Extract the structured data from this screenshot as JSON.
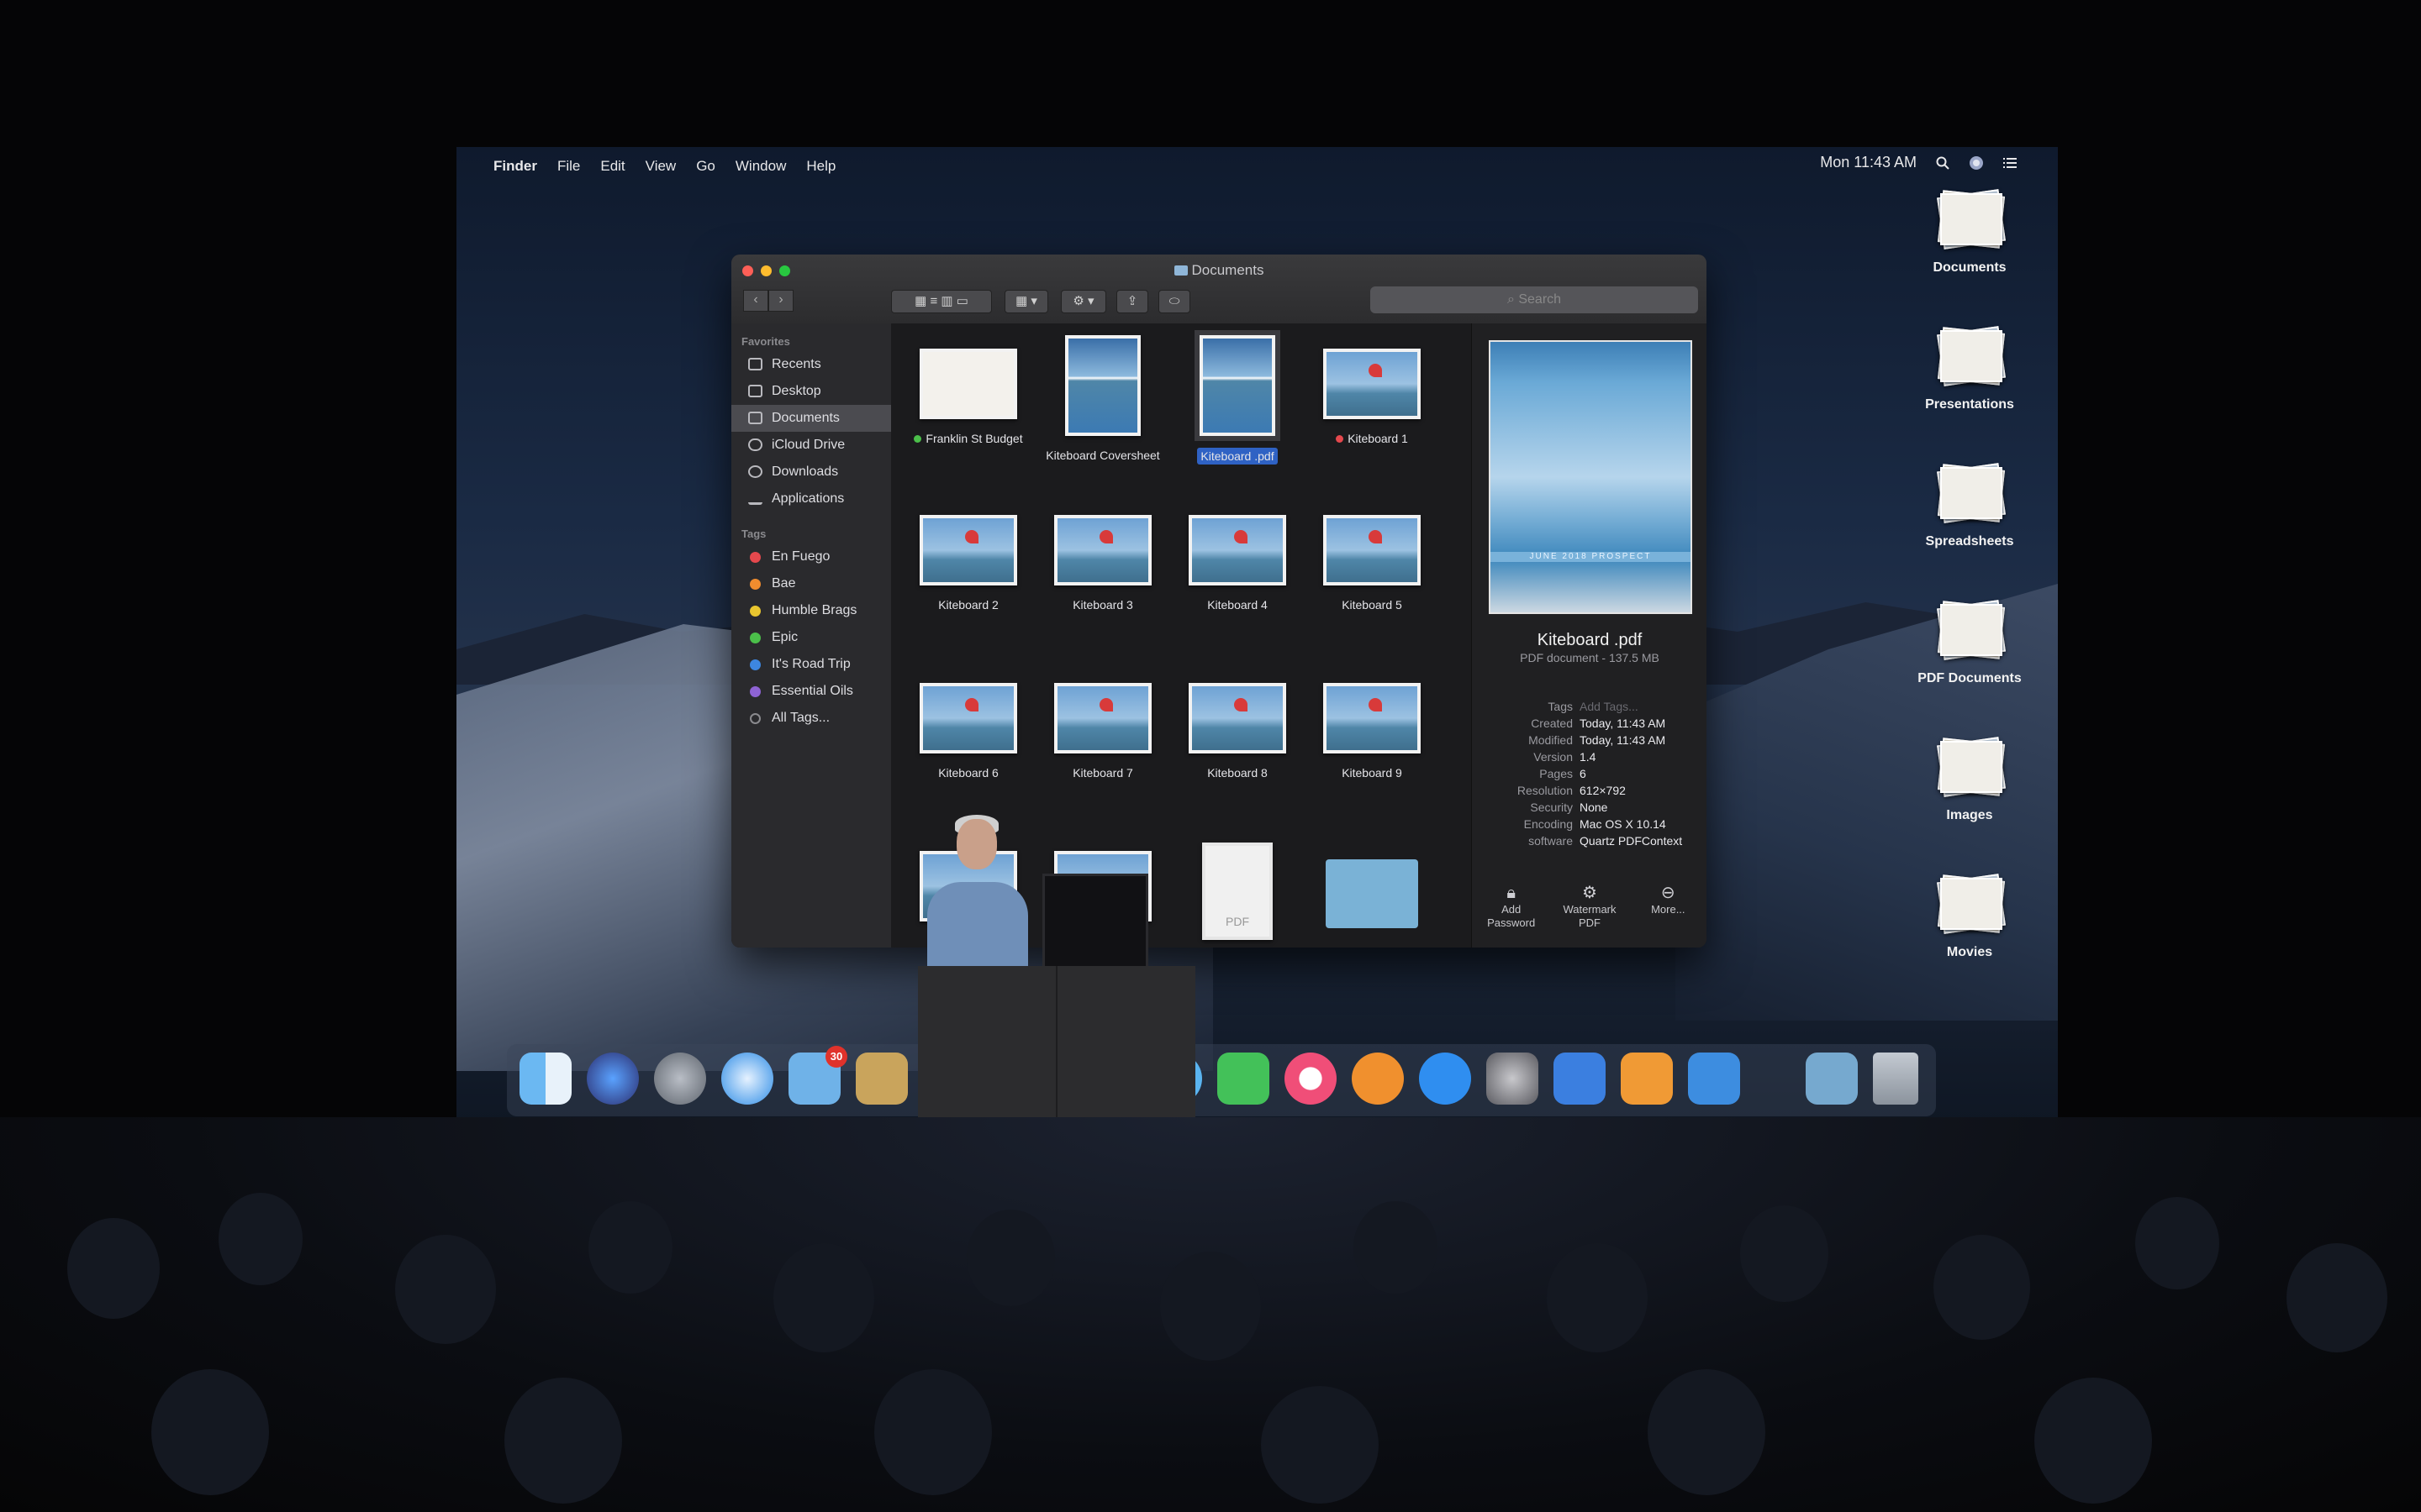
{
  "menubar": {
    "apple_glyph": "",
    "app_name": "Finder",
    "menus": [
      "File",
      "Edit",
      "View",
      "Go",
      "Window",
      "Help"
    ],
    "clock": "Mon 11:43 AM",
    "status_icons": [
      "search-icon",
      "siri-icon",
      "menu-list-icon"
    ]
  },
  "desktop_stacks": [
    {
      "label": "Documents"
    },
    {
      "label": "Presentations"
    },
    {
      "label": "Spreadsheets"
    },
    {
      "label": "PDF Documents"
    },
    {
      "label": "Images"
    },
    {
      "label": "Movies"
    }
  ],
  "finder": {
    "title": "Documents",
    "search_placeholder": "Search",
    "sidebar": {
      "favorites_heading": "Favorites",
      "favorites": [
        {
          "label": "Recents",
          "selected": false
        },
        {
          "label": "Desktop",
          "selected": false
        },
        {
          "label": "Documents",
          "selected": true
        },
        {
          "label": "iCloud Drive",
          "selected": false
        },
        {
          "label": "Downloads",
          "selected": false
        },
        {
          "label": "Applications",
          "selected": false
        }
      ],
      "tags_heading": "Tags",
      "tags": [
        {
          "label": "En Fuego",
          "color": "#e5484d"
        },
        {
          "label": "Bae",
          "color": "#f08c2e"
        },
        {
          "label": "Humble Brags",
          "color": "#e9c62f"
        },
        {
          "label": "Epic",
          "color": "#4bbf4a"
        },
        {
          "label": "It's Road Trip",
          "color": "#3d86e0"
        },
        {
          "label": "Essential Oils",
          "color": "#8e63d4"
        },
        {
          "label": "All Tags...",
          "color": "#8a8a8e"
        }
      ]
    },
    "files": [
      {
        "name": "Franklin St Budget",
        "tag_color": "#4bbf4a",
        "kind": "doc"
      },
      {
        "name": "Kiteboard Coversheet",
        "tag_color": "",
        "kind": "tall"
      },
      {
        "name": "Kiteboard .pdf",
        "tag_color": "",
        "kind": "tall",
        "selected": true
      },
      {
        "name": "Kiteboard 1",
        "tag_color": "#e5484d",
        "kind": "photo"
      },
      {
        "name": "Kiteboard 2",
        "kind": "photo"
      },
      {
        "name": "Kiteboard 3",
        "kind": "photo"
      },
      {
        "name": "Kiteboard 4",
        "kind": "photo"
      },
      {
        "name": "Kiteboard 5",
        "kind": "photo"
      },
      {
        "name": "Kiteboard 6",
        "kind": "photo"
      },
      {
        "name": "Kiteboard 7",
        "kind": "photo"
      },
      {
        "name": "Kiteboard 8",
        "kind": "photo"
      },
      {
        "name": "Kiteboard 9",
        "kind": "photo"
      }
    ],
    "bottom_row": [
      {
        "kind": "photo"
      },
      {
        "kind": "photo"
      },
      {
        "kind": "pdf",
        "label": "PDF"
      },
      {
        "kind": "folder"
      }
    ],
    "preview": {
      "banner_text": "JUNE 2018 PROSPECT",
      "title": "Kiteboard .pdf",
      "subtitle": "PDF document - 137.5 MB",
      "metadata": [
        {
          "key": "Tags",
          "value": "Add Tags...",
          "placeholder": true
        },
        {
          "key": "Created",
          "value": "Today, 11:43 AM"
        },
        {
          "key": "Modified",
          "value": "Today, 11:43 AM"
        },
        {
          "key": "Version",
          "value": "1.4"
        },
        {
          "key": "Pages",
          "value": "6"
        },
        {
          "key": "Resolution",
          "value": "612×792"
        },
        {
          "key": "Security",
          "value": "None"
        },
        {
          "key": "Encoding",
          "value": "Mac OS X 10.14"
        },
        {
          "key": "software",
          "value": "Quartz PDFContext"
        }
      ],
      "actions": [
        {
          "label": "Add Password",
          "icon": "lock-icon"
        },
        {
          "label": "Watermark PDF",
          "icon": "gear-icon"
        },
        {
          "label": "More...",
          "icon": "more-icon"
        }
      ]
    }
  },
  "dock": {
    "apps": [
      {
        "name": "Finder",
        "color": "#4aa0e8"
      },
      {
        "name": "Siri",
        "color": "#3c3f9a"
      },
      {
        "name": "Launchpad",
        "color": "#8a8f98"
      },
      {
        "name": "Safari",
        "color": "#2d8ce6"
      },
      {
        "name": "Mail",
        "color": "#6fb2e8",
        "badge": "30"
      },
      {
        "name": "Notes",
        "color": "#c9a45c"
      },
      {
        "name": "Messages",
        "color": "#5ab4f0"
      },
      {
        "name": "FaceTime",
        "color": "#43c159"
      },
      {
        "name": "iTunes",
        "color": "#f04e78"
      },
      {
        "name": "iBooks",
        "color": "#f0902e"
      },
      {
        "name": "App Store",
        "color": "#2f8ef0"
      },
      {
        "name": "System Preferences",
        "color": "#8c8c92"
      },
      {
        "name": "Keynote",
        "color": "#3b7fe0"
      },
      {
        "name": "Pages",
        "color": "#f09a35"
      },
      {
        "name": "Xcode",
        "color": "#3d8de0"
      },
      {
        "name": "Downloads Folder",
        "color": "#76a9cf"
      },
      {
        "name": "Trash",
        "color": "#9ba2ab"
      }
    ]
  }
}
